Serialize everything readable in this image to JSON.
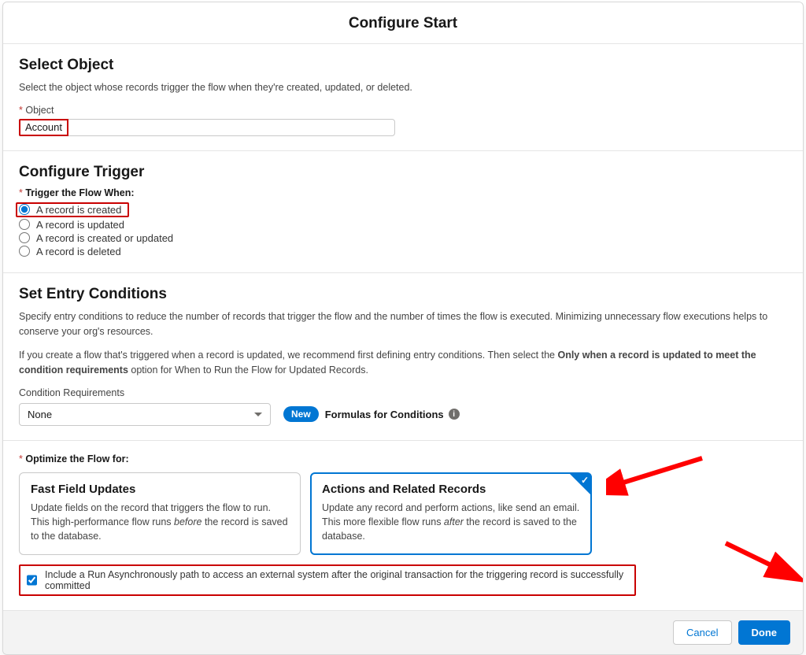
{
  "header": {
    "title": "Configure Start"
  },
  "select_object": {
    "heading": "Select Object",
    "desc": "Select the object whose records trigger the flow when they're created, updated, or deleted.",
    "label": "Object",
    "value": "Account"
  },
  "configure_trigger": {
    "heading": "Configure Trigger",
    "label": "Trigger the Flow When:",
    "options": [
      {
        "label": "A record is created",
        "selected": true
      },
      {
        "label": "A record is updated",
        "selected": false
      },
      {
        "label": "A record is created or updated",
        "selected": false
      },
      {
        "label": "A record is deleted",
        "selected": false
      }
    ]
  },
  "entry_conditions": {
    "heading": "Set Entry Conditions",
    "desc1": "Specify entry conditions to reduce the number of records that trigger the flow and the number of times the flow is executed. Minimizing unnecessary flow executions helps to conserve your org's resources.",
    "desc2_pre": "If you create a flow that's triggered when a record is updated, we recommend first defining entry conditions. Then select the ",
    "desc2_bold": "Only when a record is updated to meet the condition requirements",
    "desc2_post": " option for When to Run the Flow for Updated Records.",
    "req_label": "Condition Requirements",
    "req_value": "None",
    "new_pill": "New",
    "formulas_label": "Formulas for Conditions"
  },
  "optimize": {
    "label": "Optimize the Flow for:",
    "card1": {
      "title": "Fast Field Updates",
      "desc_pre": "Update fields on the record that triggers the flow to run. This high-performance flow runs ",
      "desc_em": "before",
      "desc_post": " the record is saved to the database."
    },
    "card2": {
      "title": "Actions and Related Records",
      "desc_pre": "Update any record and perform actions, like send an email. This more flexible flow runs ",
      "desc_em": "after",
      "desc_post": " the record is saved to the database."
    },
    "async_label": "Include a Run Asynchronously path to access an external system after the original transaction for the triggering record is successfully committed"
  },
  "footer": {
    "cancel": "Cancel",
    "done": "Done"
  }
}
